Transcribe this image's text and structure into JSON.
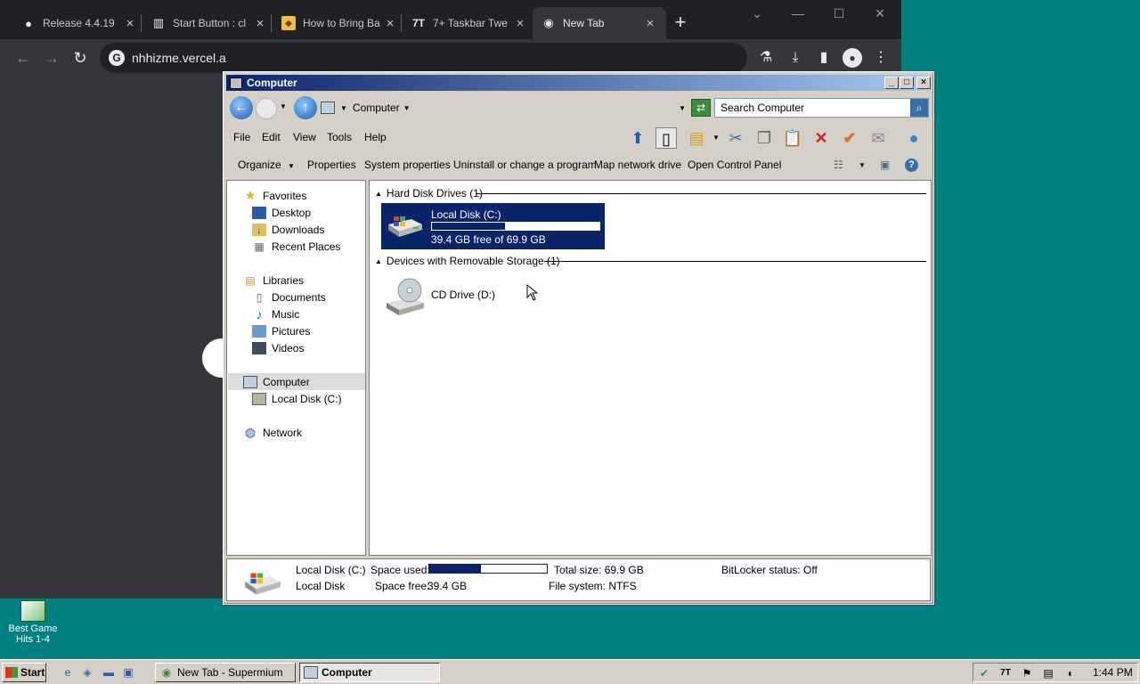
{
  "browser": {
    "tabs": [
      {
        "title": "Release 4.4.19",
        "icon": "github-icon"
      },
      {
        "title": "Start Button : cl",
        "icon": "archive-icon"
      },
      {
        "title": "How to Bring Ba",
        "icon": "site-icon"
      },
      {
        "title": "7+ Taskbar Twe",
        "icon": "7tt-icon"
      },
      {
        "title": "New Tab",
        "icon": "chrome-icon"
      }
    ],
    "address": "nhhizme.vercel.a"
  },
  "explorer": {
    "title": "Computer",
    "address": "Computer",
    "search_placeholder": "Search Computer",
    "menu": [
      "File",
      "Edit",
      "View",
      "Tools",
      "Help"
    ],
    "commands": [
      "Organize",
      "Properties",
      "System properties",
      "Uninstall or change a program",
      "Map network drive",
      "Open Control Panel"
    ],
    "nav": {
      "favorites": "Favorites",
      "desktop": "Desktop",
      "downloads": "Downloads",
      "recent": "Recent Places",
      "libraries": "Libraries",
      "documents": "Documents",
      "music": "Music",
      "pictures": "Pictures",
      "videos": "Videos",
      "computer": "Computer",
      "local_disk": "Local Disk (C:)",
      "network": "Network"
    },
    "groups": {
      "hdd": "Hard Disk Drives (1)",
      "removable": "Devices with Removable Storage (1)"
    },
    "drive_c": {
      "name": "Local Disk (C:)",
      "free_text": "39.4 GB free of 69.9 GB",
      "used_fraction": 0.436
    },
    "drive_d": {
      "name": "CD Drive (D:)"
    },
    "details": {
      "name": "Local Disk (C:)",
      "type": "Local Disk",
      "space_used_label": "Space used:",
      "space_free_label": "Space free:",
      "space_free_value": "39.4 GB",
      "total_size": "Total size: 69.9 GB",
      "file_system": "File system: NTFS",
      "bitlocker": "BitLocker status: Off",
      "used_fraction": 0.436
    }
  },
  "desktop": {
    "icon_label_1": "Best Game",
    "icon_label_2": "Hits 1-4"
  },
  "taskbar": {
    "start": "Start",
    "tasks": [
      "New Tab - Supermium",
      "Computer"
    ],
    "clock": "1:44 PM"
  }
}
